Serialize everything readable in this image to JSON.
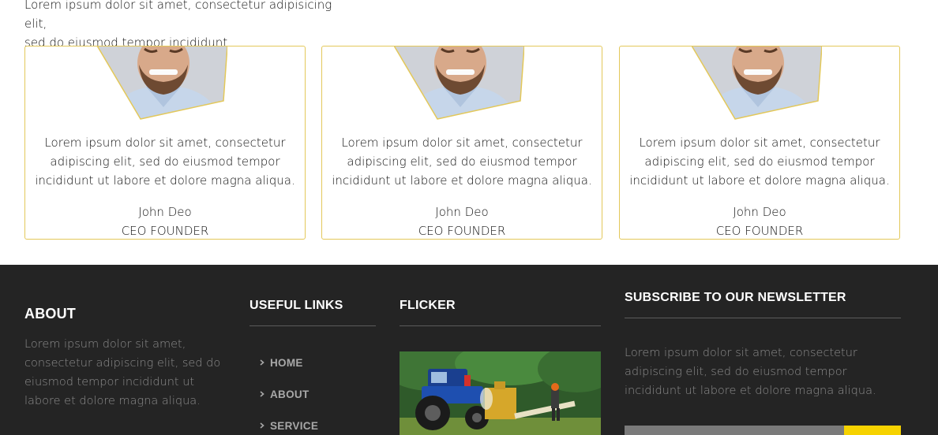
{
  "intro": {
    "line1": "Lorem ipsum dolor sit amet, consectetur adipisicing elit,",
    "line2": "sed do eiusmod tempor incididunt."
  },
  "testimonials": [
    {
      "quote": "Lorem ipsum dolor sit amet, consectetur adipiscing elit, sed do eiusmod tempor incididunt ut labore et dolore magna aliqua.",
      "name": "John Deo",
      "role": "CEO FOUNDER"
    },
    {
      "quote": "Lorem ipsum dolor sit amet, consectetur adipiscing elit, sed do eiusmod tempor incididunt ut labore et dolore magna aliqua.",
      "name": "John Deo",
      "role": "CEO FOUNDER"
    },
    {
      "quote": "Lorem ipsum dolor sit amet, consectetur adipiscing elit, sed do eiusmod tempor incididunt ut labore et dolore magna aliqua.",
      "name": "John Deo",
      "role": "CEO FOUNDER"
    }
  ],
  "footer": {
    "about": {
      "title": "ABOUT",
      "text": "Lorem ipsum dolor sit amet, consectetur adipiscing elit, sed do eiusmod tempor incididunt ut labore et dolore magna aliqua."
    },
    "links": {
      "title": "USEFUL LINKS",
      "items": [
        {
          "label": "HOME",
          "icon": "chevron-right-icon"
        },
        {
          "label": "ABOUT",
          "icon": "chevron-right-icon"
        },
        {
          "label": "SERVICE",
          "icon": "chevron-right-icon"
        }
      ]
    },
    "flicker": {
      "title": "FLICKER"
    },
    "newsletter": {
      "title": "SUBSCRIBE TO OUR NEWSLETTER",
      "text": "Lorem ipsum dolor sit amet, consectetur adipiscing elit, sed do eiusmod tempor incididunt ut labore et dolore magna aliqua.",
      "email_placeholder": ""
    }
  },
  "colors": {
    "accent": "#f6d200",
    "card_border": "#e3c85a",
    "footer_bg": "#242424"
  }
}
